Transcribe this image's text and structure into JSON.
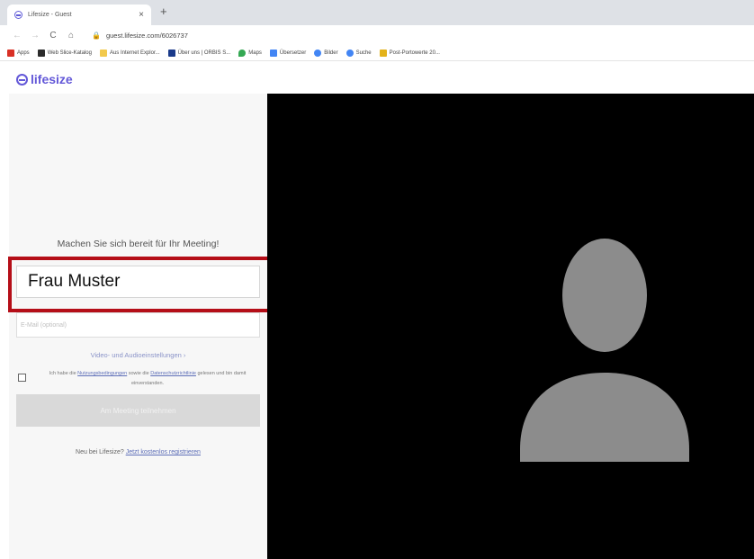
{
  "browser": {
    "tab_title": "Lifesize - Guest",
    "tab_close": "×",
    "new_tab": "+",
    "nav_back": "←",
    "nav_forward": "→",
    "nav_reload": "C",
    "nav_home": "⌂",
    "url": "guest.lifesize.com/6026737",
    "bookmarks": [
      {
        "label": "Apps",
        "color": "#d93025"
      },
      {
        "label": "Web Slice-Katalog",
        "color": "#2b2b2b"
      },
      {
        "label": "Aus Internet Explor...",
        "color": "#f2c94c"
      },
      {
        "label": "Über uns | ORBIS S...",
        "color": "#1a3a8a"
      },
      {
        "label": "Maps",
        "color": "#34a853"
      },
      {
        "label": "Übersetzer",
        "color": "#4285f4"
      },
      {
        "label": "Bilder",
        "color": "#4285f4"
      },
      {
        "label": "Suche",
        "color": "#4285f4"
      },
      {
        "label": "Post-Portowerte 20...",
        "color": "#e3b21a"
      }
    ]
  },
  "logo": {
    "text": "lifesize"
  },
  "form": {
    "heading": "Machen Sie sich bereit für Ihr Meeting!",
    "name_value": "Frau Muster",
    "email_placeholder": "E-Mail (optional)",
    "av_settings": "Video- und Audioeinstellungen ›",
    "terms_prefix": "Ich habe die",
    "terms_link1": "Nutzungsbedingungen",
    "terms_middle": "sowie die",
    "terms_link2": "Datenschutzrichtlinie",
    "terms_suffix": "gelesen und bin damit einverstanden.",
    "join_button": "Am Meeting teilnehmen",
    "signup_prefix": "Neu bei Lifesize?",
    "signup_link": "Jetzt kostenlos registrieren"
  },
  "colors": {
    "brand": "#6358d8",
    "highlight": "#b50e18",
    "avatar": "#8c8c8c",
    "video_bg": "#000000"
  }
}
